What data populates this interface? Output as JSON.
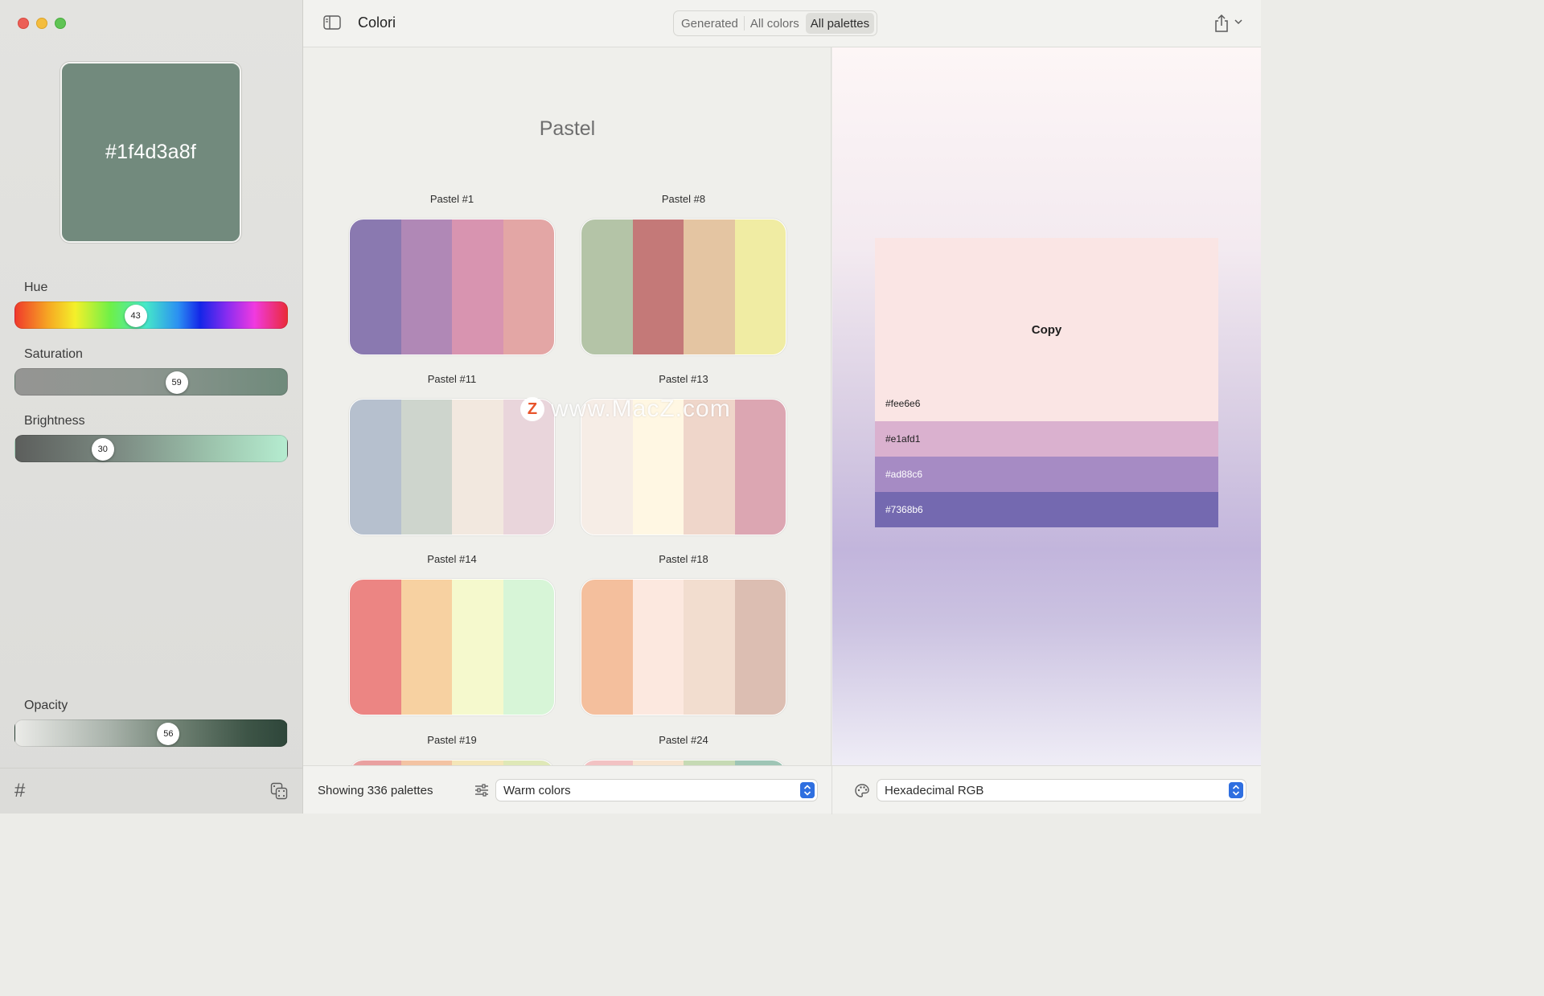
{
  "window": {
    "controls": [
      "close",
      "minimize",
      "zoom"
    ]
  },
  "sidebar": {
    "preview": {
      "hex_label": "#1f4d3a8f",
      "swatch_color": "#728a7d"
    },
    "sliders": {
      "hue": {
        "label": "Hue",
        "value": "43",
        "fraction": 0.44
      },
      "saturation": {
        "label": "Saturation",
        "value": "59",
        "fraction": 0.59
      },
      "brightness": {
        "label": "Brightness",
        "value": "30",
        "fraction": 0.32
      },
      "opacity": {
        "label": "Opacity",
        "value": "56",
        "fraction": 0.56
      }
    },
    "bottom": {
      "hash_symbol": "#",
      "dice_icon": "dice-icon"
    }
  },
  "toolbar": {
    "title": "Colori",
    "tabs": [
      {
        "label": "Generated",
        "active": false
      },
      {
        "label": "All colors",
        "active": false
      },
      {
        "label": "All palettes",
        "active": true
      }
    ],
    "icons": [
      "sidebar-toggle-icon",
      "share-icon",
      "chevron-down-icon"
    ]
  },
  "palettes": {
    "section_title": "Pastel",
    "items": [
      {
        "name": "Pastel #1",
        "colors": [
          "#8a79b0",
          "#b088b6",
          "#d894b0",
          "#e3a6a5"
        ]
      },
      {
        "name": "Pastel #8",
        "colors": [
          "#b4c4a7",
          "#c47978",
          "#e4c5a2",
          "#f0eca3"
        ]
      },
      {
        "name": "Pastel #11",
        "colors": [
          "#b6c0ce",
          "#ced5cd",
          "#f2e8df",
          "#e9d5db"
        ]
      },
      {
        "name": "Pastel #13",
        "colors": [
          "#f6ede6",
          "#fff7e3",
          "#efd6ca",
          "#dca6b2"
        ]
      },
      {
        "name": "Pastel #14",
        "colors": [
          "#ec8583",
          "#f7d1a1",
          "#f5f9cd",
          "#d7f5d7"
        ]
      },
      {
        "name": "Pastel #18",
        "colors": [
          "#f4bf9d",
          "#fce8df",
          "#f2ddcf",
          "#dcbeb2"
        ]
      },
      {
        "name": "Pastel #19",
        "colors": [
          "#e9a0a0",
          "#f3c3a3",
          "#f4e6b8",
          "#dfe8b7"
        ]
      },
      {
        "name": "Pastel #24",
        "colors": [
          "#f2c2c3",
          "#f7e4cf",
          "#c6dab4",
          "#9ec5b5"
        ]
      }
    ]
  },
  "watermark": {
    "logo_letter": "Z",
    "text": "www.MacZ.com"
  },
  "bottom_bar": {
    "count_text": "Showing 336 palettes",
    "filter_value": "Warm colors",
    "format_value": "Hexadecimal RGB"
  },
  "detail": {
    "copy_label": "Copy",
    "swatches": [
      {
        "hex": "#fee6e6",
        "color": "#fae5e4"
      },
      {
        "hex": "#e1afd1",
        "color": "#dab1cf"
      },
      {
        "hex": "#ad88c6",
        "color": "#a68bc4"
      },
      {
        "hex": "#7368b6",
        "color": "#7469b0"
      }
    ]
  }
}
